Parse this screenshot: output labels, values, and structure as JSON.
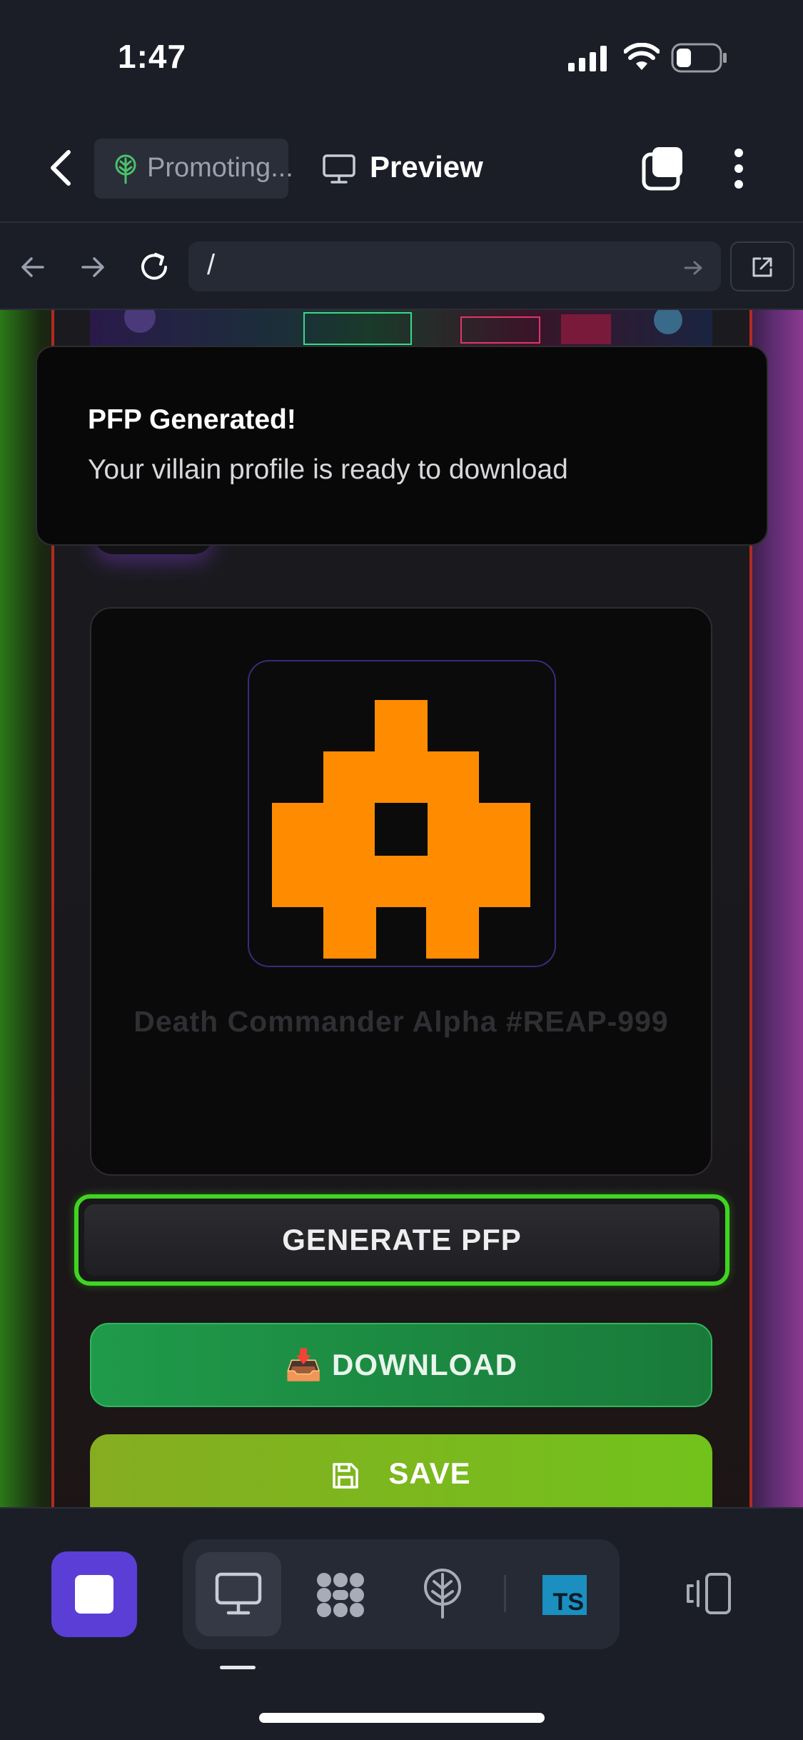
{
  "status_bar": {
    "time": "1:47"
  },
  "top_bar": {
    "project_chip": "Promoting...",
    "preview_label": "Preview"
  },
  "url_bar": {
    "path": "/"
  },
  "toast": {
    "title": "PFP Generated!",
    "message": "Your villain profile is ready to download"
  },
  "pfp": {
    "name": "Death Commander Alpha #REAP-999",
    "pixel_color": "#ff8c00"
  },
  "buttons": {
    "generate": "GENERATE PFP",
    "download": "📥 DOWNLOAD",
    "save": "SAVE"
  },
  "bottom_bar": {
    "ts_badge": "TS",
    "accent": "#5b3ed6"
  }
}
